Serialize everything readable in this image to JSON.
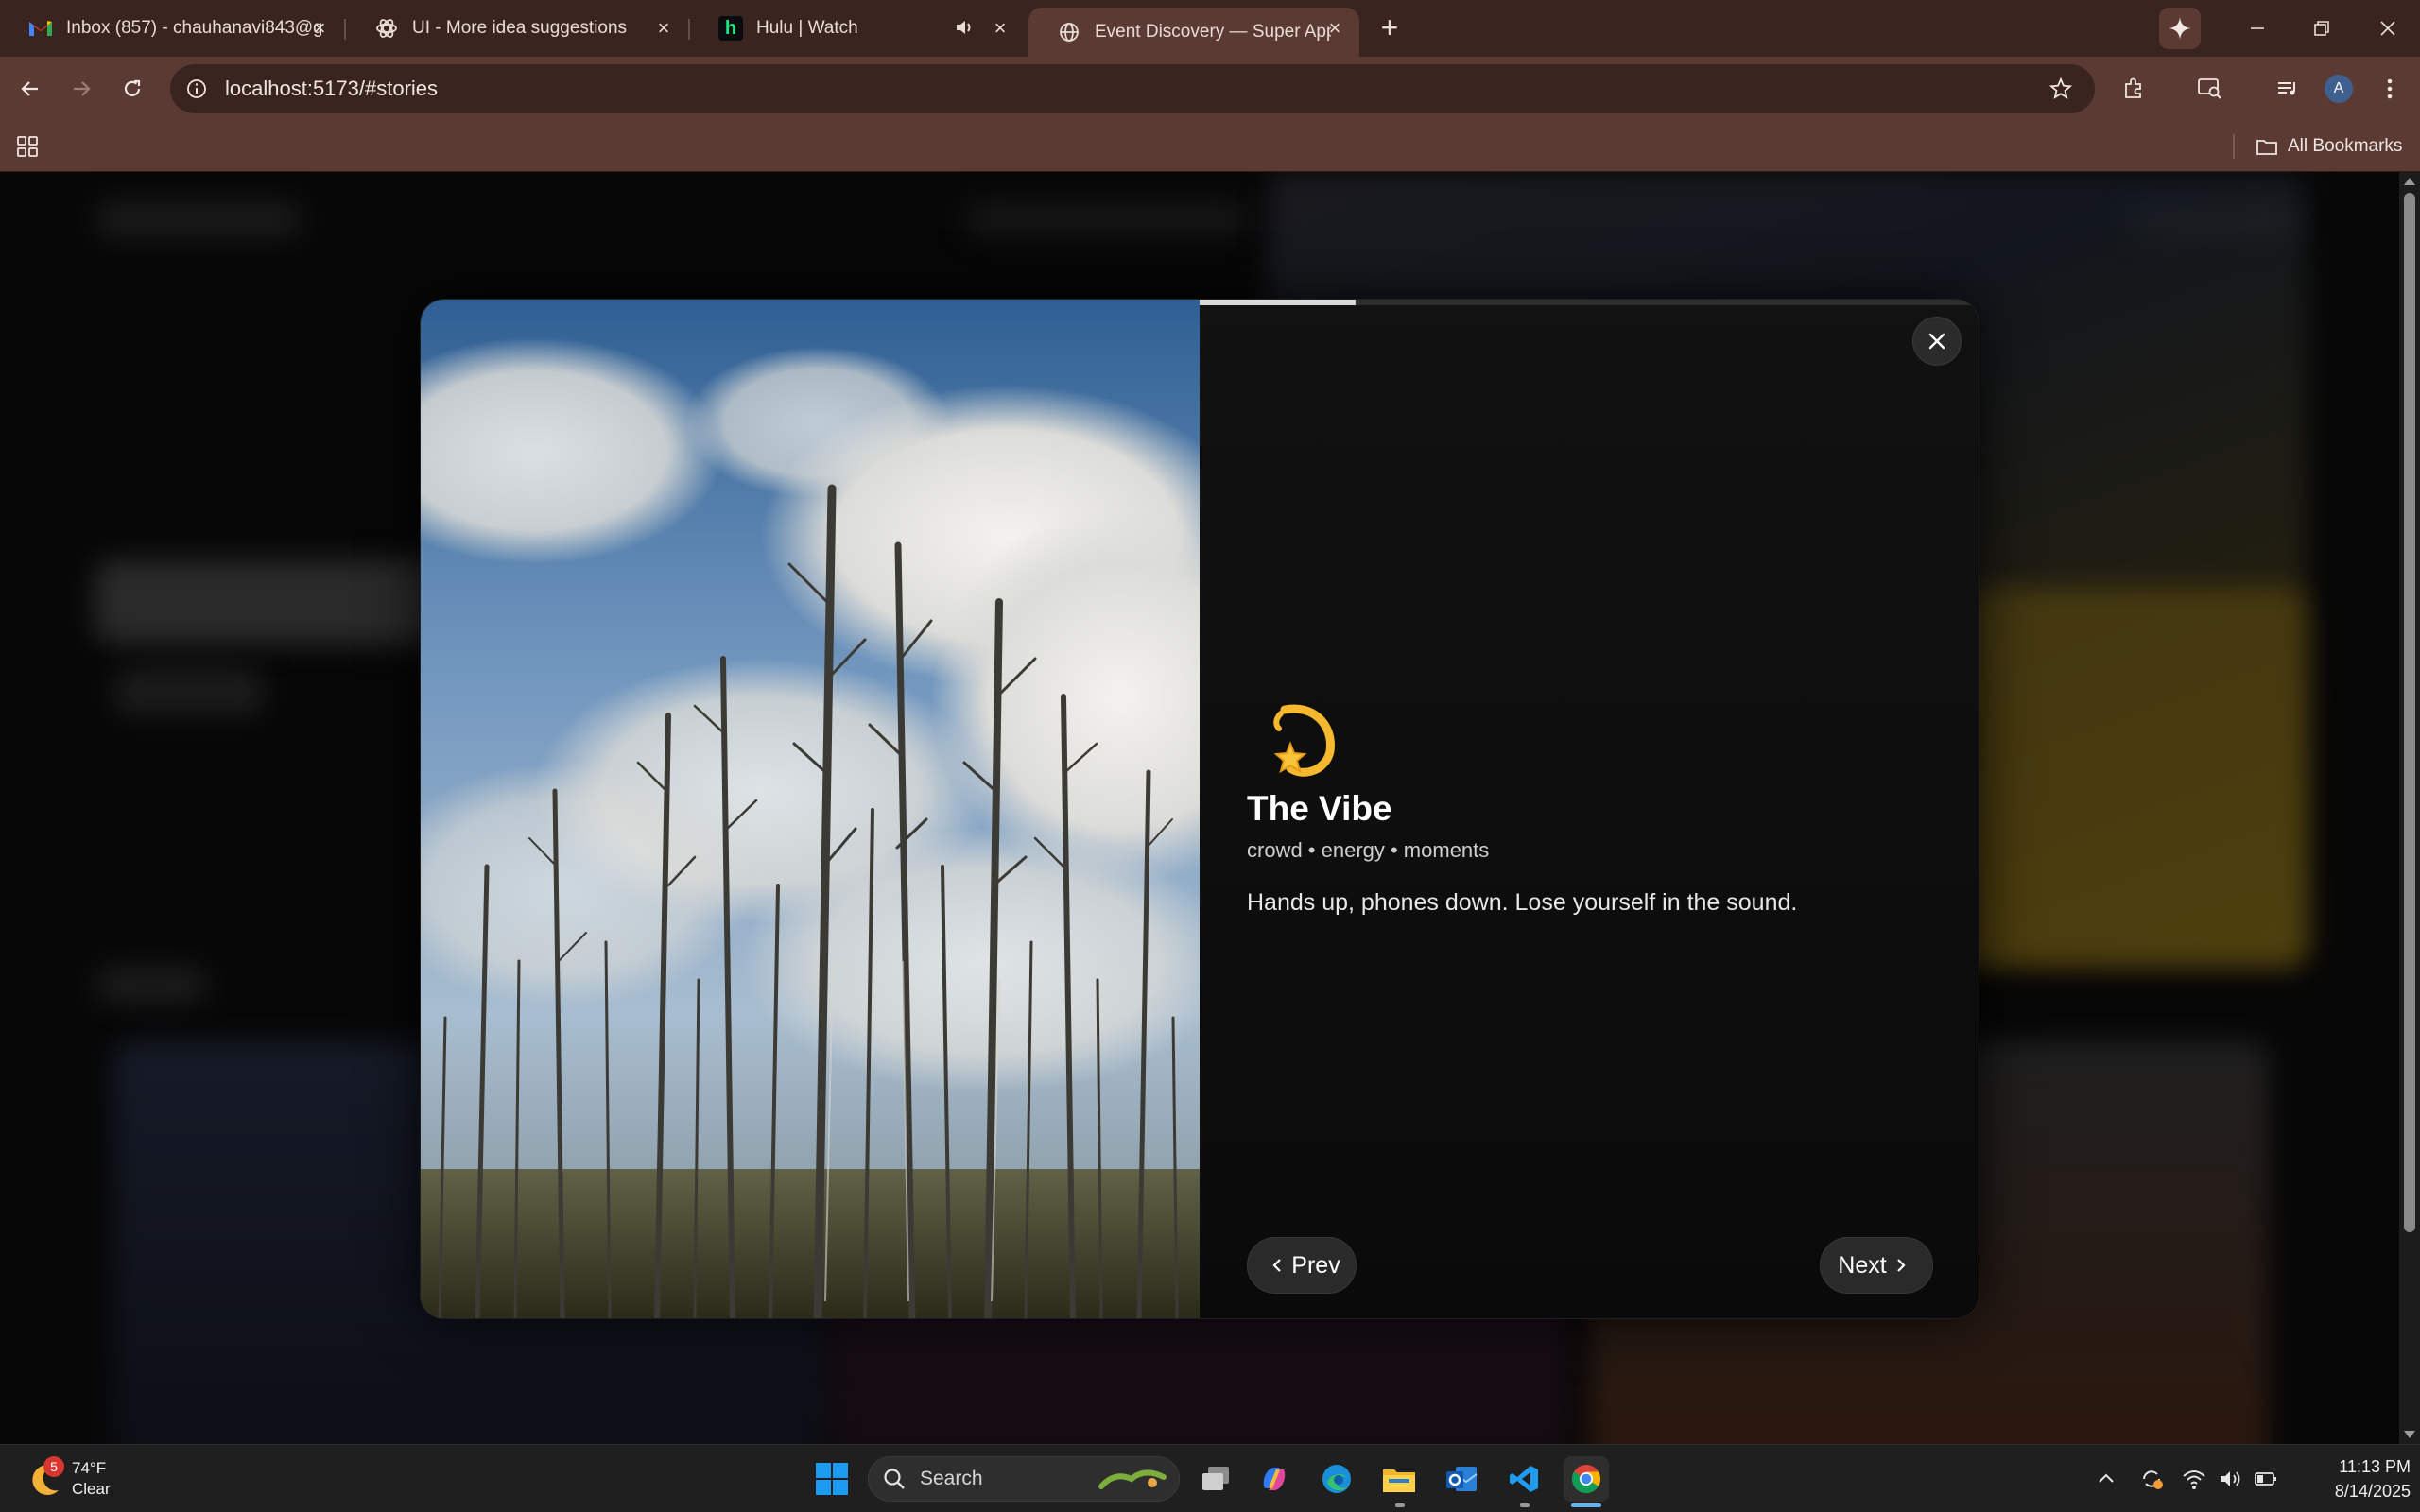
{
  "browser": {
    "tabs": [
      {
        "title": "Inbox (857) - chauhanavi843@g",
        "favicon": "gmail-icon",
        "active": false
      },
      {
        "title": "UI - More idea suggestions",
        "favicon": "chatgpt-icon",
        "active": false
      },
      {
        "title": "Hulu | Watch",
        "favicon": "hulu-icon",
        "favicon_letter": "h",
        "audio": true,
        "active": false
      },
      {
        "title": "Event Discovery — Super App",
        "favicon": "globe-icon",
        "active": true
      }
    ],
    "url": "localhost:5173/#stories",
    "bookmarks_label": "All Bookmarks",
    "profile_letter": "A"
  },
  "story": {
    "emoji": "💫",
    "title": "The Vibe",
    "tags": "crowd • energy • moments",
    "text": "Hands up, phones down. Lose yourself in the sound.",
    "progress": 0.2,
    "prev_label": "Prev",
    "next_label": "Next"
  },
  "taskbar": {
    "weather_temp": "74°F",
    "weather_cond": "Clear",
    "weather_badge": "5",
    "search_label": "Search",
    "time": "11:13 PM",
    "date": "8/14/2025"
  },
  "colors": {
    "titlebar": "#3a2420",
    "toolbar": "#5a3a33",
    "accent_gold": "#f5b82e",
    "windows_blue": "#1d9bf0"
  }
}
